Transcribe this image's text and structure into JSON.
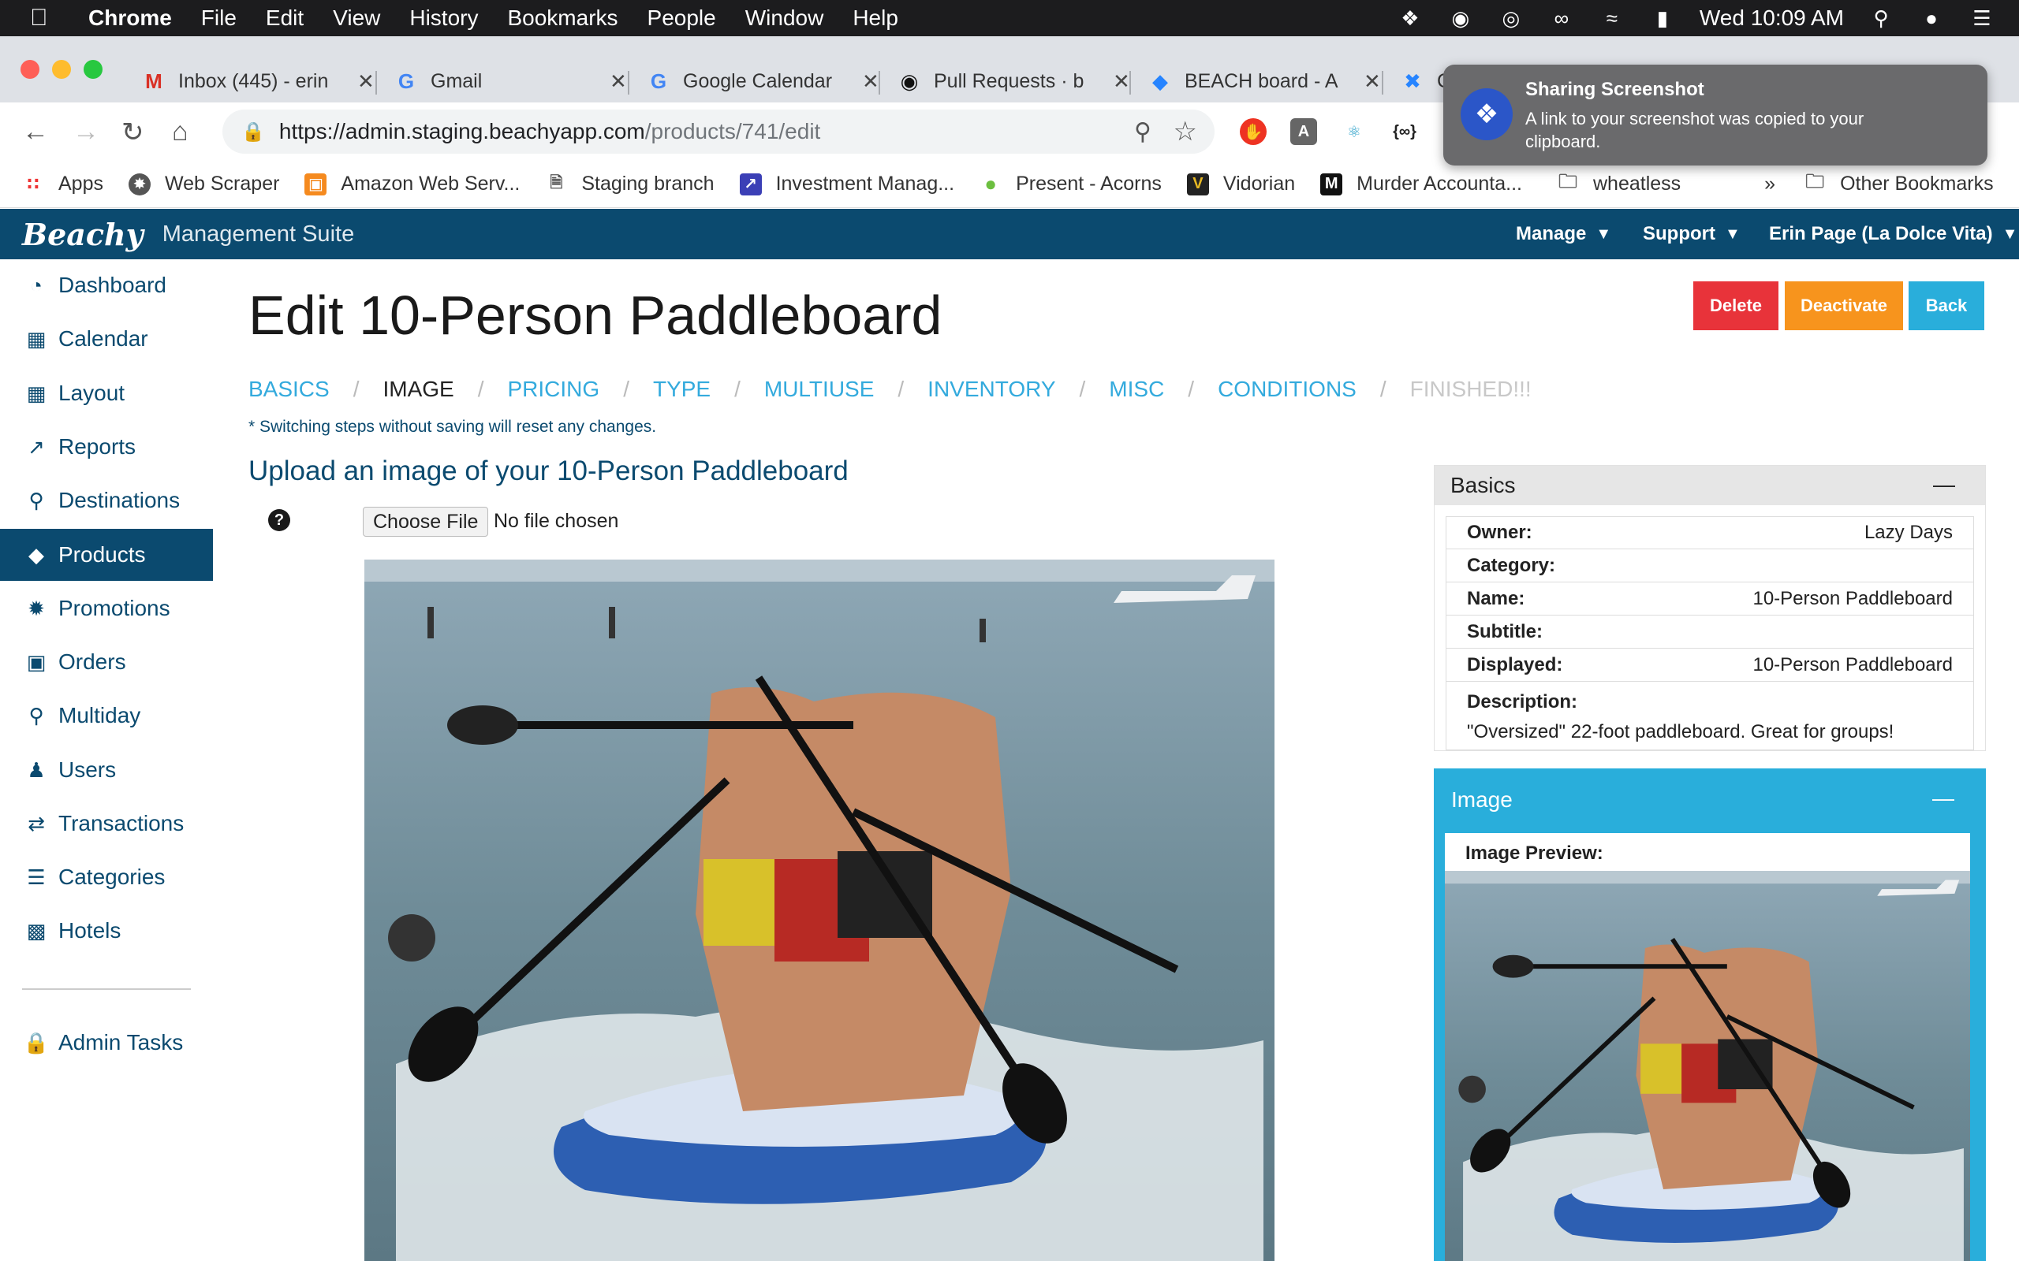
{
  "menubar": {
    "app": "Chrome",
    "items": [
      "File",
      "Edit",
      "View",
      "History",
      "Bookmarks",
      "People",
      "Window",
      "Help"
    ],
    "clock": "Wed 10:09 AM"
  },
  "tabs": [
    {
      "label": "Inbox (445) - erin",
      "icon": "gmail-icon"
    },
    {
      "label": "Gmail",
      "icon": "google-icon"
    },
    {
      "label": "Google Calendar",
      "icon": "google-icon"
    },
    {
      "label": "Pull Requests · b",
      "icon": "github-icon"
    },
    {
      "label": "BEACH board - A",
      "icon": "jira-icon"
    },
    {
      "label": "C",
      "icon": "confluence-icon"
    }
  ],
  "address": {
    "host": "https://admin.staging.beachyapp.com",
    "path": "/products/741/edit"
  },
  "bookmarks": [
    {
      "label": "Apps"
    },
    {
      "label": "Web Scraper"
    },
    {
      "label": "Amazon Web Serv..."
    },
    {
      "label": "Staging branch"
    },
    {
      "label": "Investment Manag..."
    },
    {
      "label": "Present - Acorns"
    },
    {
      "label": "Vidorian"
    },
    {
      "label": "Murder Accounta..."
    },
    {
      "label": "wheatless"
    },
    {
      "label": "»"
    },
    {
      "label": "Other Bookmarks"
    }
  ],
  "notification": {
    "title": "Sharing Screenshot",
    "text": "A link to your screenshot was copied to your clipboard."
  },
  "header": {
    "logo": "Beachy",
    "suite": "Management Suite",
    "nav": [
      "Manage",
      "Support",
      "Erin Page (La Dolce Vita)"
    ]
  },
  "sidebar": {
    "items": [
      {
        "label": "Dashboard",
        "icon": "dashboard-icon"
      },
      {
        "label": "Calendar",
        "icon": "calendar-icon"
      },
      {
        "label": "Layout",
        "icon": "grid-icon"
      },
      {
        "label": "Reports",
        "icon": "chart-icon"
      },
      {
        "label": "Destinations",
        "icon": "map-pin-icon"
      },
      {
        "label": "Products",
        "icon": "tag-icon",
        "active": true
      },
      {
        "label": "Promotions",
        "icon": "badge-icon"
      },
      {
        "label": "Orders",
        "icon": "credit-card-icon"
      },
      {
        "label": "Multiday",
        "icon": "search-icon"
      },
      {
        "label": "Users",
        "icon": "user-icon"
      },
      {
        "label": "Transactions",
        "icon": "exchange-icon"
      },
      {
        "label": "Categories",
        "icon": "list-icon"
      },
      {
        "label": "Hotels",
        "icon": "building-icon"
      }
    ],
    "admin": {
      "label": "Admin Tasks",
      "icon": "lock-icon"
    }
  },
  "page": {
    "title": "Edit 10-Person Paddleboard",
    "buttons": {
      "delete": "Delete",
      "deactivate": "Deactivate",
      "back": "Back"
    },
    "steps": [
      "BASICS",
      "IMAGE",
      "PRICING",
      "TYPE",
      "MULTIUSE",
      "INVENTORY",
      "MISC",
      "CONDITIONS",
      "FINISHED!!!"
    ],
    "current_step": "IMAGE",
    "warning": "* Switching steps without saving will reset any changes.",
    "upload_title": "Upload an image of your 10-Person Paddleboard",
    "help": "?",
    "file_button": "Choose File",
    "file_status": "No file chosen"
  },
  "basics": {
    "title": "Basics",
    "collapse": "—",
    "owner_label": "Owner:",
    "owner": "Lazy Days",
    "category_label": "Category:",
    "category": "",
    "name_label": "Name:",
    "name": "10-Person Paddleboard",
    "subtitle_label": "Subtitle:",
    "subtitle": "",
    "displayed_label": "Displayed:",
    "displayed": "10-Person Paddleboard",
    "description_label": "Description:",
    "description": "\"Oversized\" 22-foot paddleboard. Great for groups!"
  },
  "image_panel": {
    "title": "Image",
    "collapse": "—",
    "preview_label": "Image Preview:"
  },
  "colors": {
    "brand": "#0b4a6f",
    "link": "#33aadd",
    "delete": "#e8333a",
    "deactivate": "#f7941d",
    "back": "#29aedb"
  }
}
